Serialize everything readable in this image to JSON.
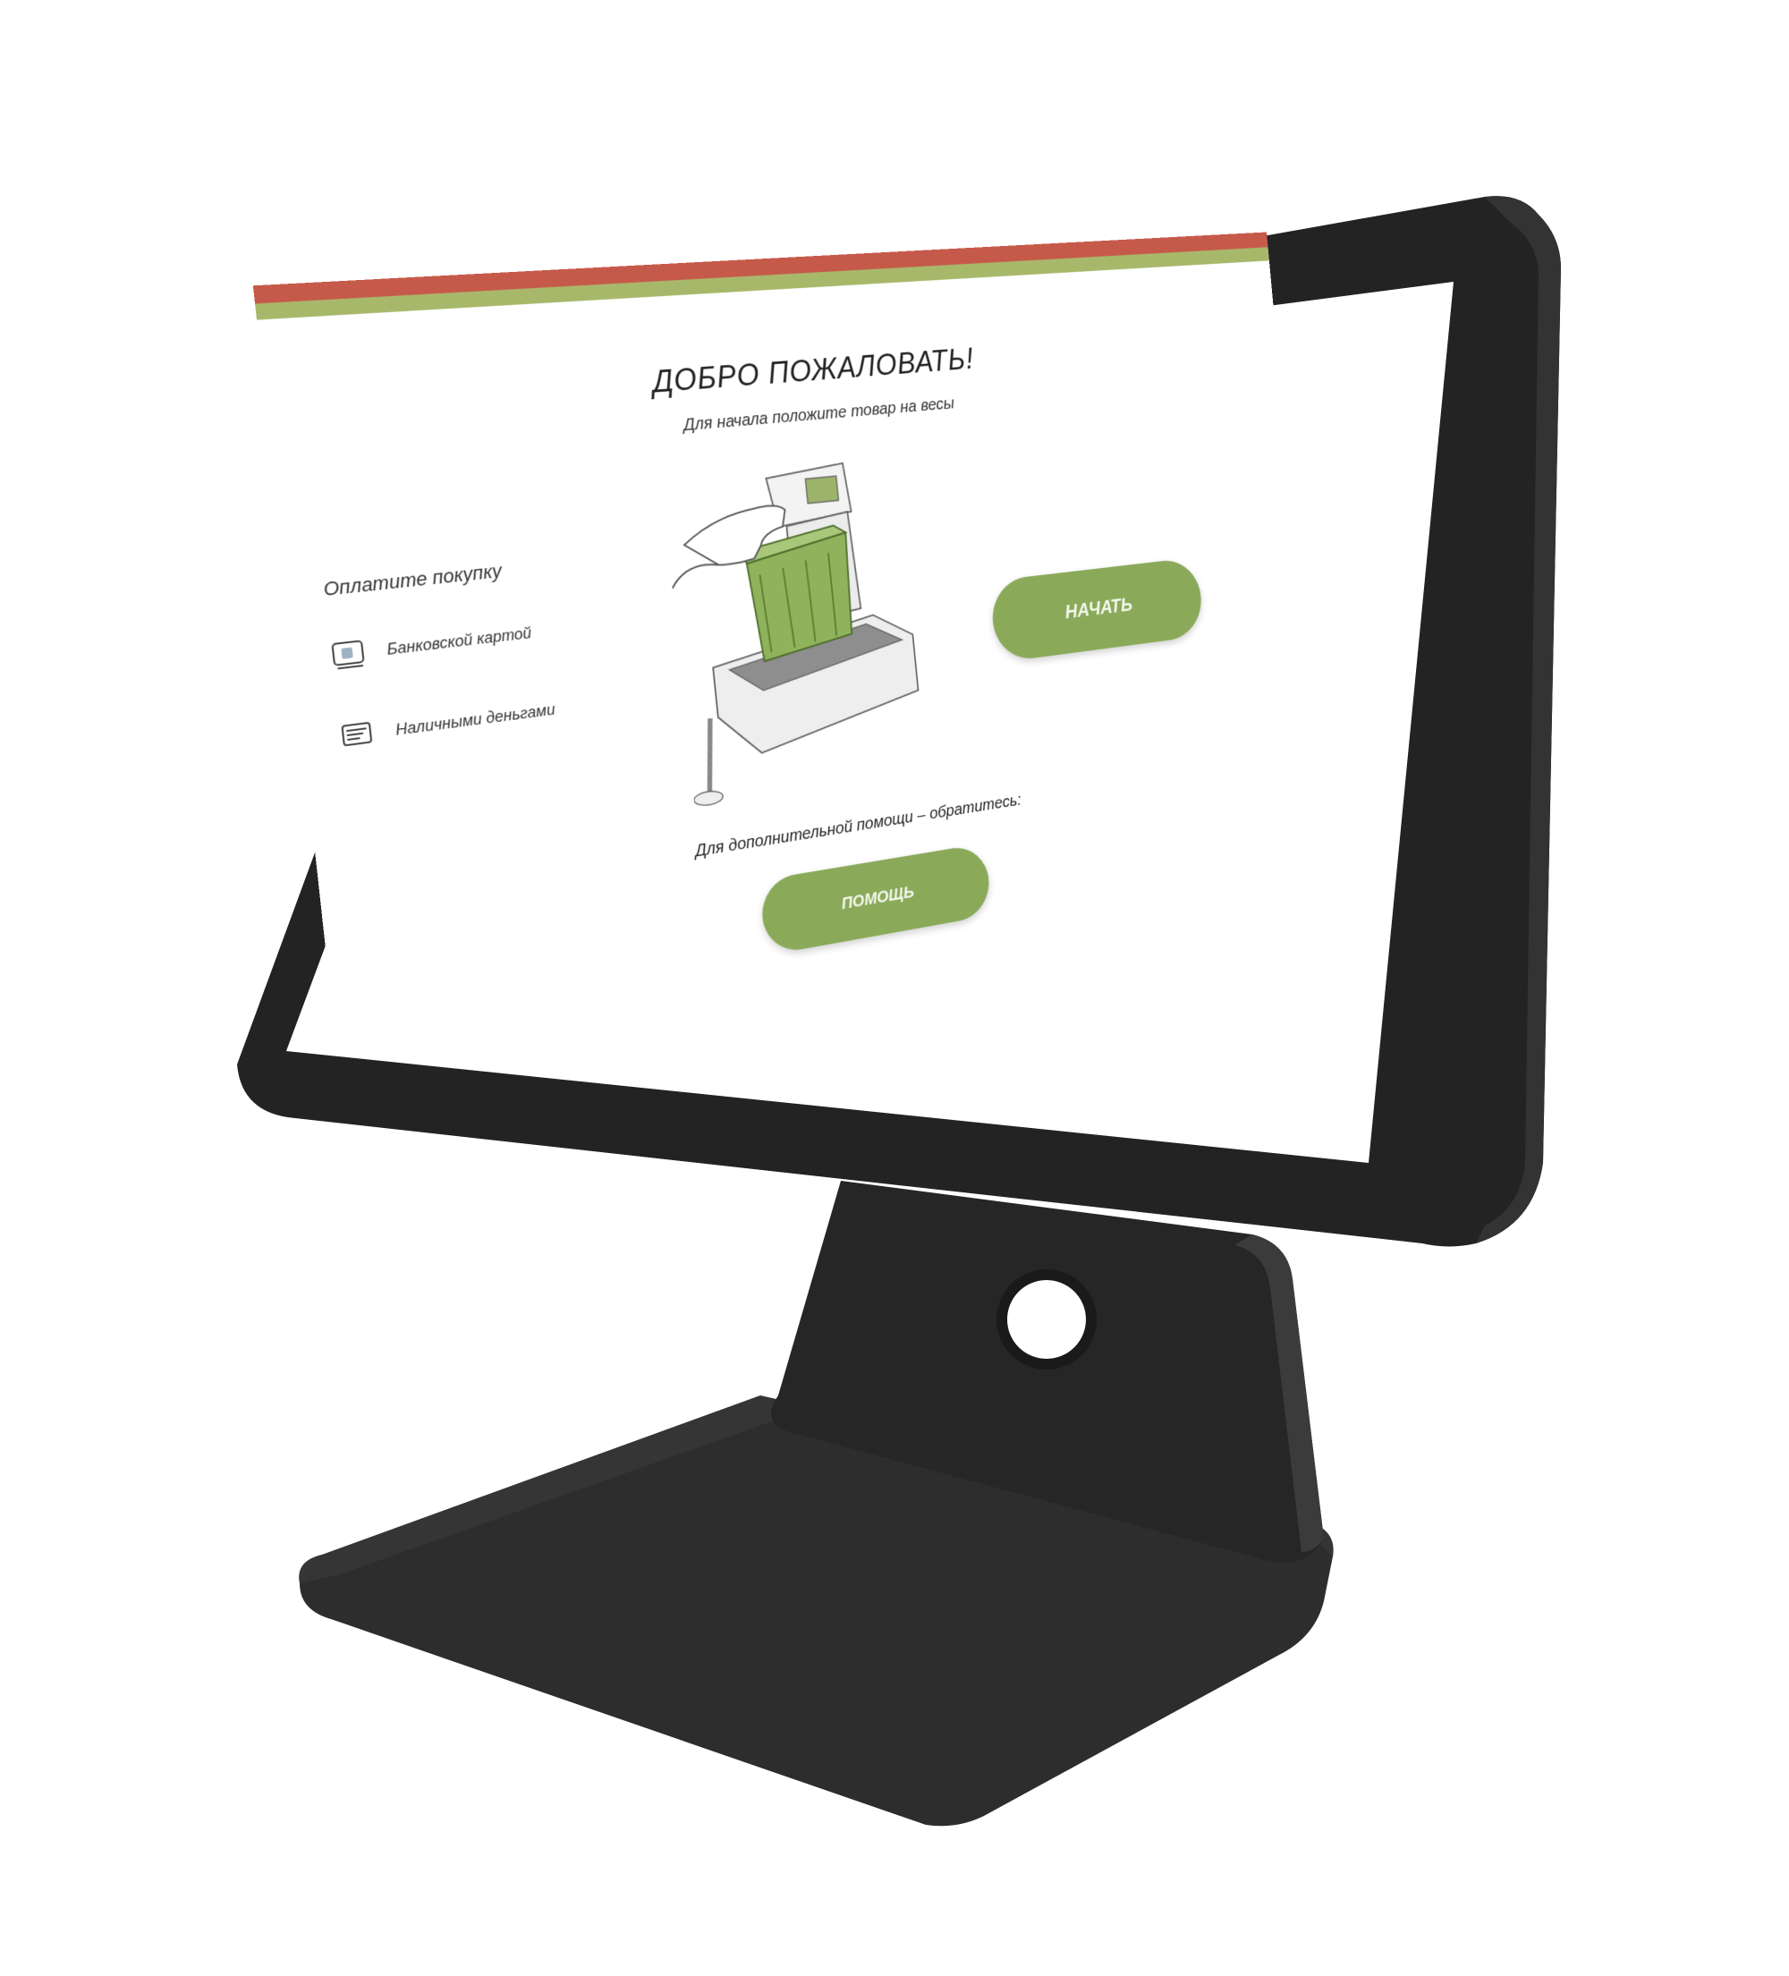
{
  "screen": {
    "title": "ДОБРО ПОЖАЛОВАТЬ!",
    "subtitle": "Для начала положите товар на весы",
    "left_heading": "Оплатите покупку",
    "options": [
      {
        "label": "Банковской картой",
        "icon": "card-icon"
      },
      {
        "label": "Наличными деньгами",
        "icon": "cash-icon"
      }
    ],
    "start_button_label": "НАЧАТЬ",
    "bottom_text": "Для дополнительной помощи – обратитесь:",
    "help_button_label": "ПОМОЩЬ"
  },
  "colors": {
    "accent_green": "#8aaa5a",
    "top_band_red": "#c65a4a",
    "top_band_green": "#a8b86b",
    "device_body": "#2b2b2b"
  }
}
